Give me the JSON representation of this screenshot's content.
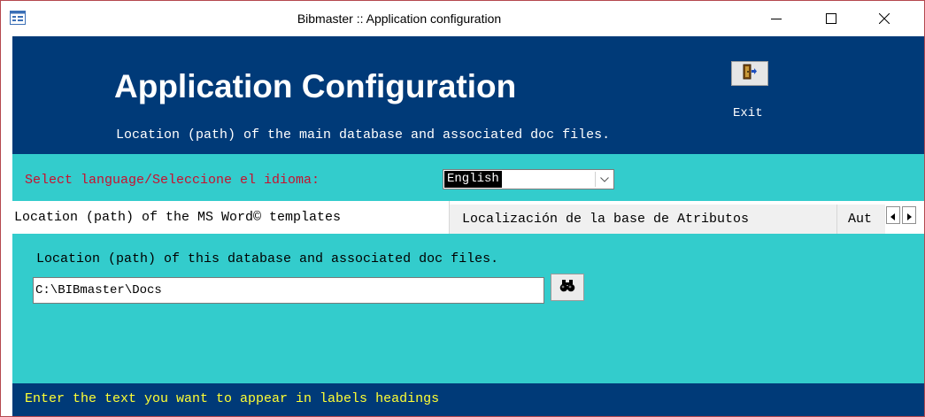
{
  "window": {
    "title": "Bibmaster :: Application configuration",
    "icon": "form-icon",
    "controls": [
      "minimize-icon",
      "maximize-icon",
      "close-icon"
    ]
  },
  "header": {
    "title": "Application Configuration",
    "subtitle": "Location (path) of the main database and associated doc files.",
    "exit_label": "Exit",
    "exit_icon": "exit-door-icon"
  },
  "language": {
    "label": "Select language/Seleccione el idioma:",
    "selected": "English"
  },
  "tabs": [
    {
      "label": "Location (path) of the MS Word© templates"
    },
    {
      "label": "Localización de la base de Atributos"
    },
    {
      "label": "Aut"
    }
  ],
  "panel": {
    "label": "Location (path) of this database and associated doc files.",
    "path_value": "C:\\BIBmaster\\Docs",
    "browse_icon": "binoculars-icon"
  },
  "status": {
    "text": "Enter the text you want to appear in labels headings"
  },
  "colors": {
    "header_bg": "#003a78",
    "panel_bg": "#33cccc",
    "label_red": "#c8102e",
    "status_text": "#ffff33"
  }
}
